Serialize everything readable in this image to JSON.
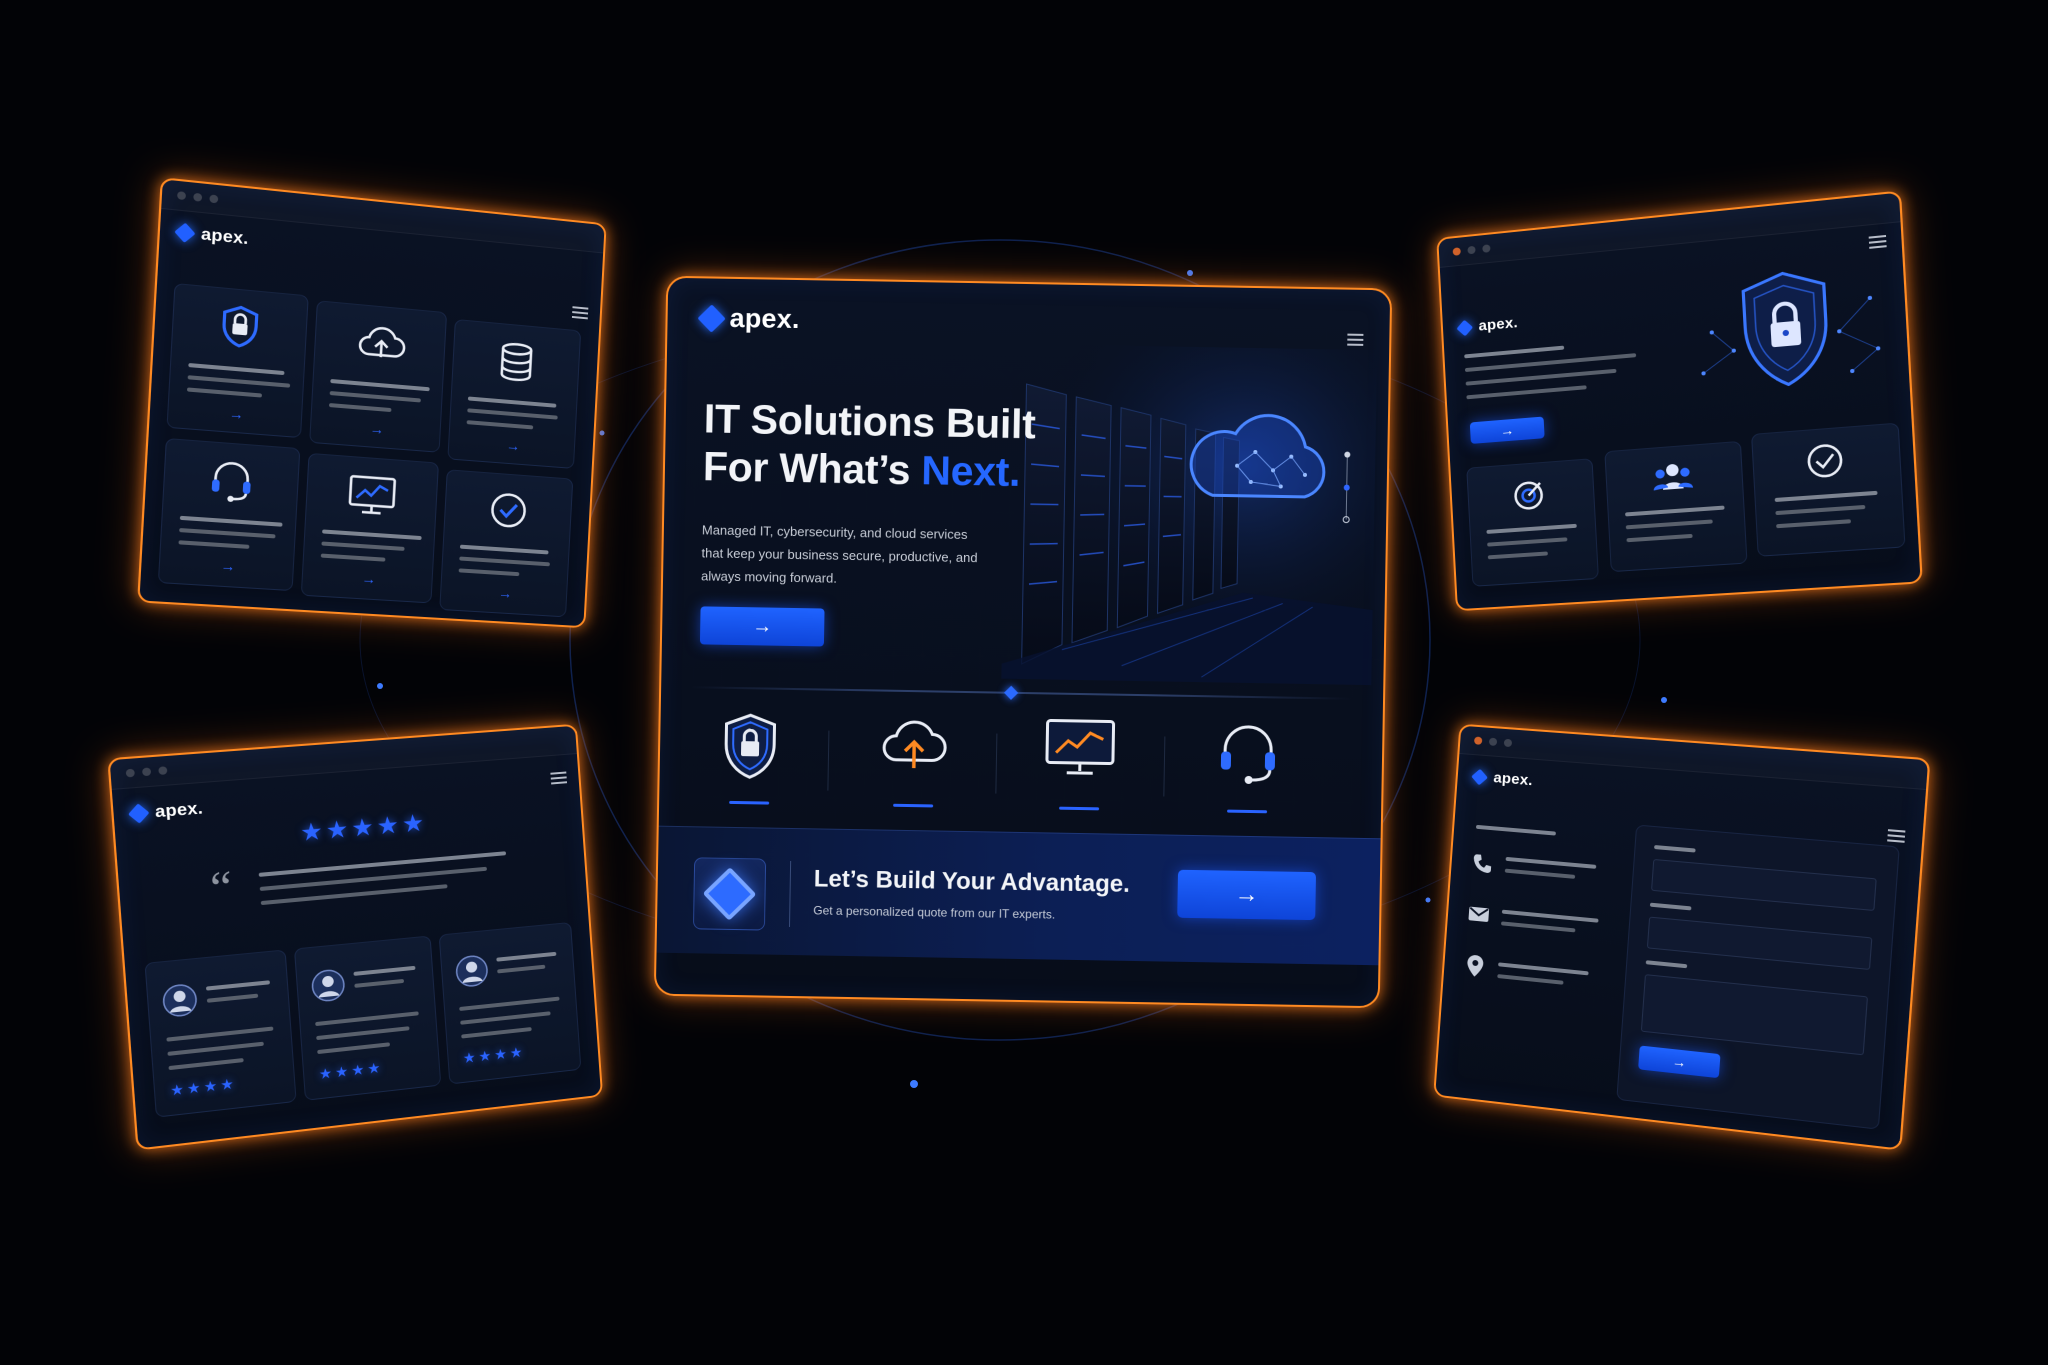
{
  "brand": {
    "name": "apex."
  },
  "hero": {
    "title_line1": "IT Solutions Built",
    "title_line2": "For What’s ",
    "title_accent": "Next.",
    "subtitle": "Managed IT, cybersecurity, and cloud services that keep your business secure, productive, and always moving forward.",
    "cta_arrow": "→"
  },
  "services": [
    {
      "icon": "shield-lock-icon"
    },
    {
      "icon": "cloud-upload-icon"
    },
    {
      "icon": "monitor-chart-icon"
    },
    {
      "icon": "headset-icon"
    }
  ],
  "cta": {
    "title": "Let’s Build Your Advantage.",
    "subtitle": "Get a personalized quote from our IT experts.",
    "arrow": "→"
  },
  "panels": {
    "services_grid": {
      "icons": [
        "shield-lock-icon",
        "cloud-upload-icon",
        "database-icon",
        "headset-icon",
        "monitor-chart-icon",
        "check-circle-icon"
      ],
      "arrow": "→"
    },
    "testimonials": {
      "rating_stars": "★★★★★",
      "card_stars": "★★★★",
      "quote_mark": "“"
    },
    "security": {
      "cta_arrow": "→",
      "icons": [
        "target-icon",
        "team-icon",
        "check-circle-icon"
      ]
    },
    "contact": {
      "icons": [
        "phone-icon",
        "mail-icon",
        "location-pin-icon"
      ],
      "submit_arrow": "→"
    }
  },
  "colors": {
    "accent": "#2563ff",
    "frame": "#ff8a22",
    "background": "#020306",
    "panel": "#0a1224"
  }
}
